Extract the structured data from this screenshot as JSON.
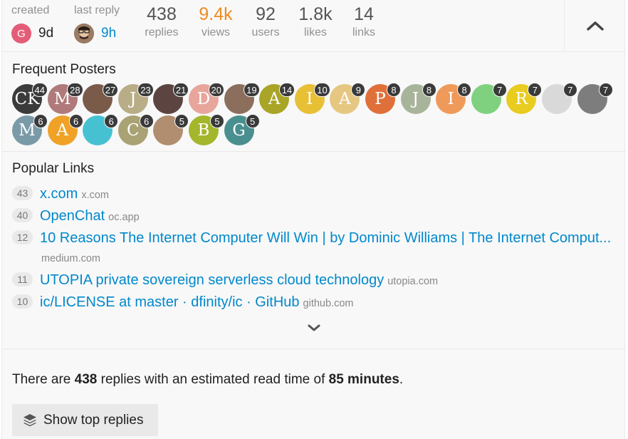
{
  "stats": {
    "created": {
      "label": "created",
      "avatar_letter": "G",
      "avatar_color": "#e45d78",
      "value": "9d"
    },
    "last_reply": {
      "label": "last reply",
      "value": "9h"
    },
    "replies": {
      "value": "438",
      "label": "replies"
    },
    "views": {
      "value": "9.4k",
      "label": "views",
      "color": "#ee8b22"
    },
    "users": {
      "value": "92",
      "label": "users"
    },
    "likes": {
      "value": "1.8k",
      "label": "likes"
    },
    "links": {
      "value": "14",
      "label": "links"
    },
    "collapse_icon": "chevron-up-icon"
  },
  "frequent_posters": {
    "title": "Frequent Posters",
    "rows": [
      [
        {
          "letter": "CK",
          "color": "#3b3b3b",
          "count": "44"
        },
        {
          "letter": "M",
          "color": "#b07a7a",
          "count": "28"
        },
        {
          "letter": "",
          "color": "#7a5b4a",
          "count": "27"
        },
        {
          "letter": "J",
          "color": "#b8ad86",
          "count": "23"
        },
        {
          "letter": "",
          "color": "#5c4540",
          "count": "21"
        },
        {
          "letter": "D",
          "color": "#e7a59b",
          "count": "20"
        },
        {
          "letter": "",
          "color": "#8b6f5c",
          "count": "19"
        },
        {
          "letter": "A",
          "color": "#a9a526",
          "count": "14"
        },
        {
          "letter": "I",
          "color": "#e8c035",
          "count": "10"
        },
        {
          "letter": "A",
          "color": "#e6c782",
          "count": "9"
        },
        {
          "letter": "P",
          "color": "#e0703a",
          "count": "8"
        },
        {
          "letter": "J",
          "color": "#a8b49a",
          "count": "8"
        },
        {
          "letter": "I",
          "color": "#ef9a5a",
          "count": "8"
        },
        {
          "letter": "",
          "color": "#7fd17f",
          "count": "7"
        },
        {
          "letter": "R",
          "color": "#e8cc20",
          "count": "7"
        },
        {
          "letter": "",
          "color": "#d9d9d9",
          "count": "7"
        },
        {
          "letter": "",
          "color": "#7d7d7d",
          "count": "7"
        }
      ],
      [
        {
          "letter": "M",
          "color": "#7b9aa8",
          "count": "6"
        },
        {
          "letter": "A",
          "color": "#f0a227",
          "count": "6"
        },
        {
          "letter": "",
          "color": "#46c1d1",
          "count": "6"
        },
        {
          "letter": "C",
          "color": "#a9a274",
          "count": "6"
        },
        {
          "letter": "",
          "color": "#b08e6f",
          "count": "5"
        },
        {
          "letter": "B",
          "color": "#a4b62b",
          "count": "5"
        },
        {
          "letter": "G",
          "color": "#4a8f8f",
          "count": "5"
        }
      ]
    ]
  },
  "popular_links": {
    "title": "Popular Links",
    "items": [
      {
        "clicks": "43",
        "title": "x.com",
        "domain": "x.com"
      },
      {
        "clicks": "40",
        "title": "OpenChat",
        "domain": "oc.app"
      },
      {
        "clicks": "12",
        "title": "10 Reasons The Internet Computer Will Win | by Dominic Williams | The Internet Comput...",
        "domain": "medium.com"
      },
      {
        "clicks": "11",
        "title": "UTOPIA private sovereign serverless cloud technology",
        "domain": "utopia.com"
      },
      {
        "clicks": "10",
        "title": "ic/LICENSE at master · dfinity/ic · GitHub",
        "domain": "github.com"
      }
    ],
    "expand_icon": "chevron-down-icon"
  },
  "summary": {
    "prefix": "There are ",
    "replies": "438",
    "middle": " replies with an estimated read time of ",
    "minutes": "85 minutes",
    "suffix": "."
  },
  "top_replies_button": {
    "label": "Show top replies",
    "icon": "layers-icon"
  }
}
